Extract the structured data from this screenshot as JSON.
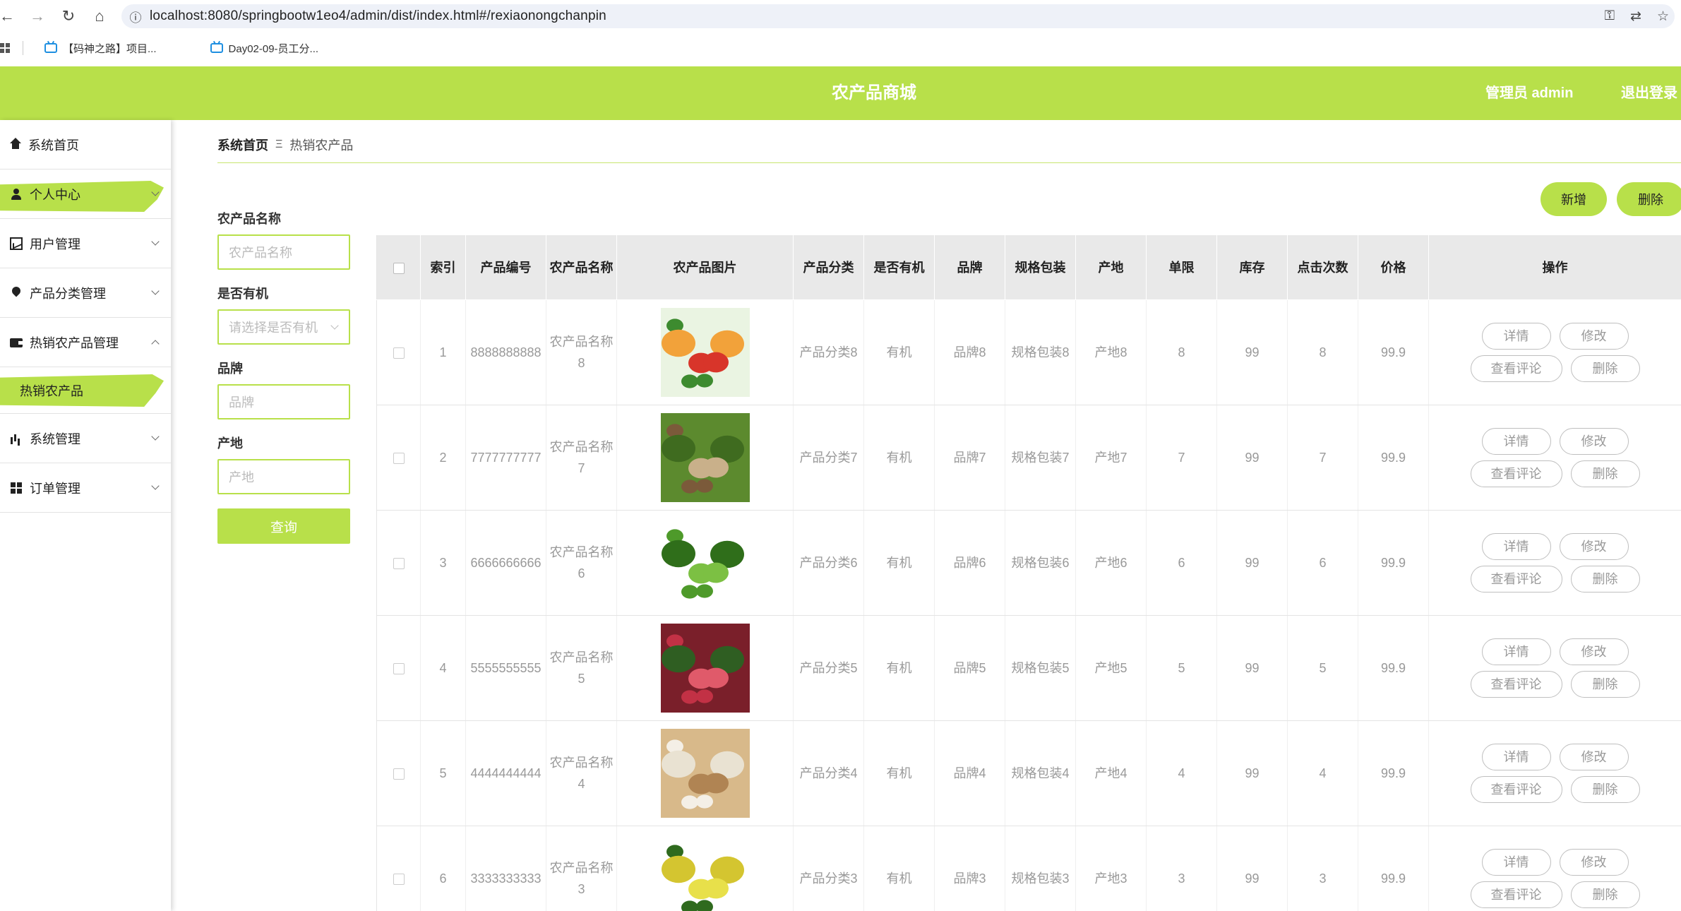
{
  "browser": {
    "url": "localhost:8080/springbootw1eo4/admin/dist/index.html#/rexiaonongchanpin",
    "bookmarks": [
      "【码神之路】项目...",
      "Day02-09-员工分..."
    ]
  },
  "header": {
    "title": "农产品商城",
    "user": "管理员 admin",
    "logout": "退出登录"
  },
  "sidebar": {
    "items": [
      {
        "label": "系统首页"
      },
      {
        "label": "个人中心"
      },
      {
        "label": "用户管理"
      },
      {
        "label": "产品分类管理"
      },
      {
        "label": "热销农产品管理"
      },
      {
        "label": "热销农产品"
      },
      {
        "label": "系统管理"
      },
      {
        "label": "订单管理"
      }
    ]
  },
  "breadcrumb": {
    "home": "系统首页",
    "sep": "Ξ",
    "current": "热销农产品"
  },
  "toolbar": {
    "add": "新增",
    "delete": "删除"
  },
  "filters": {
    "name_label": "农产品名称",
    "name_placeholder": "农产品名称",
    "organic_label": "是否有机",
    "organic_placeholder": "请选择是否有机",
    "brand_label": "品牌",
    "brand_placeholder": "品牌",
    "origin_label": "产地",
    "origin_placeholder": "产地",
    "query": "查询"
  },
  "table": {
    "headers": [
      "",
      "索引",
      "产品编号",
      "农产品名称",
      "农产品图片",
      "产品分类",
      "是否有机",
      "品牌",
      "规格包装",
      "产地",
      "单限",
      "库存",
      "点击次数",
      "价格",
      "操作"
    ],
    "actions": {
      "detail": "详情",
      "edit": "修改",
      "comments": "查看评论",
      "delete": "删除"
    },
    "rows": [
      {
        "index": "1",
        "code": "8888888888",
        "name": "农产品名称8",
        "category": "产品分类8",
        "organic": "有机",
        "brand": "品牌8",
        "spec": "规格包装8",
        "origin": "产地8",
        "limit": "8",
        "stock": "99",
        "clicks": "8",
        "price": "99.9"
      },
      {
        "index": "2",
        "code": "7777777777",
        "name": "农产品名称7",
        "category": "产品分类7",
        "organic": "有机",
        "brand": "品牌7",
        "spec": "规格包装7",
        "origin": "产地7",
        "limit": "7",
        "stock": "99",
        "clicks": "7",
        "price": "99.9"
      },
      {
        "index": "3",
        "code": "6666666666",
        "name": "农产品名称6",
        "category": "产品分类6",
        "organic": "有机",
        "brand": "品牌6",
        "spec": "规格包装6",
        "origin": "产地6",
        "limit": "6",
        "stock": "99",
        "clicks": "6",
        "price": "99.9"
      },
      {
        "index": "4",
        "code": "5555555555",
        "name": "农产品名称5",
        "category": "产品分类5",
        "organic": "有机",
        "brand": "品牌5",
        "spec": "规格包装5",
        "origin": "产地5",
        "limit": "5",
        "stock": "99",
        "clicks": "5",
        "price": "99.9"
      },
      {
        "index": "5",
        "code": "4444444444",
        "name": "农产品名称4",
        "category": "产品分类4",
        "organic": "有机",
        "brand": "品牌4",
        "spec": "规格包装4",
        "origin": "产地4",
        "limit": "4",
        "stock": "99",
        "clicks": "4",
        "price": "99.9"
      },
      {
        "index": "6",
        "code": "3333333333",
        "name": "农产品名称3",
        "category": "产品分类3",
        "organic": "有机",
        "brand": "品牌3",
        "spec": "规格包装3",
        "origin": "产地3",
        "limit": "3",
        "stock": "99",
        "clicks": "3",
        "price": "99.9"
      }
    ]
  },
  "colors": {
    "accent": "#b8e04a",
    "header_bg": "#e9e9e9"
  }
}
